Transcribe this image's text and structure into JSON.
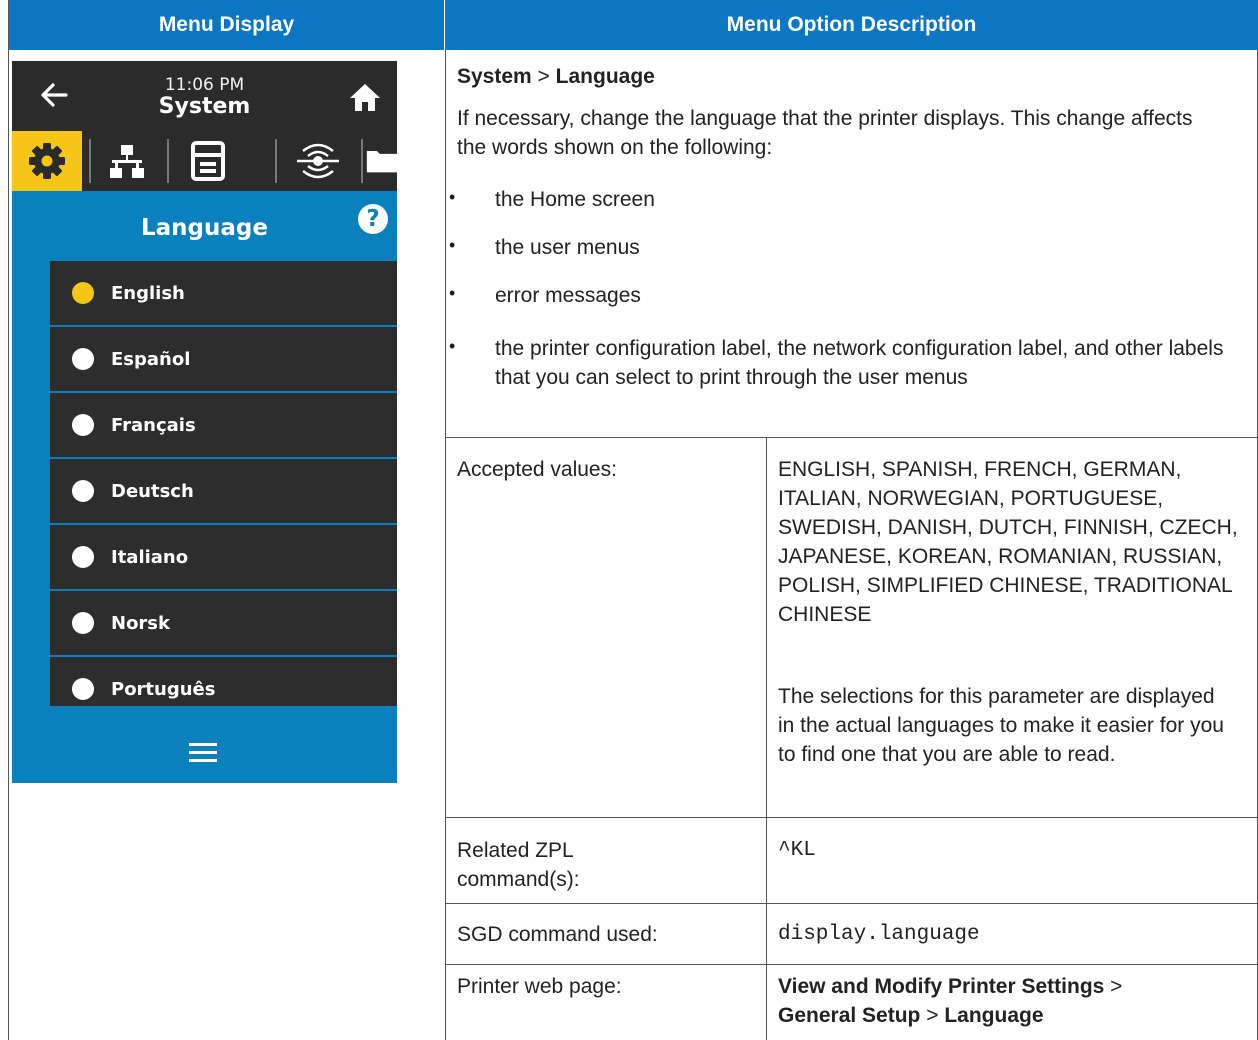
{
  "headers": {
    "left": "Menu Display",
    "right": "Menu Option Description"
  },
  "device": {
    "time": "11:06 PM",
    "title": "System",
    "section": "Language",
    "help": "?",
    "languages": [
      {
        "label": "English",
        "selected": true
      },
      {
        "label": "Español",
        "selected": false
      },
      {
        "label": "Français",
        "selected": false
      },
      {
        "label": "Deutsch",
        "selected": false
      },
      {
        "label": "Italiano",
        "selected": false
      },
      {
        "label": "Norsk",
        "selected": false
      },
      {
        "label": "Português",
        "selected": false
      }
    ],
    "tabs": [
      "gear-icon",
      "network-icon",
      "printer-icon",
      "connectivity-icon",
      "folder-icon"
    ],
    "accent": "#f5c518",
    "screen_bg": "#0a80bd"
  },
  "description": {
    "path_system": "System",
    "path_sep": " > ",
    "path_language": "Language",
    "intro": "If necessary, change the language that the printer displays. This change affects the words shown on the following:",
    "bullets": [
      "the Home screen",
      "the user menus",
      "error messages",
      "the printer configuration label, the network configuration label, and other labels that you can select to print through the user menus"
    ]
  },
  "rows": {
    "accepted_label": "Accepted values:",
    "accepted_values": "ENGLISH, SPANISH, FRENCH, GERMAN, ITALIAN, NORWEGIAN, PORTUGUESE, SWEDISH, DANISH, DUTCH, FINNISH, CZECH, JAPANESE, KOREAN, ROMANIAN, RUSSIAN, POLISH, SIMPLIFIED CHINESE, TRADITIONAL CHINESE",
    "accepted_note": "The selections for this parameter are displayed in the actual languages to make it easier for you to find one that you are able to read.",
    "zpl_label": "Related ZPL command(s):",
    "zpl_value": "^KL",
    "sgd_label": "SGD command used:",
    "sgd_value": "display.language",
    "web_label": "Printer web page:",
    "web_part1": "View and Modify Printer Settings",
    "web_sep": " > ",
    "web_part2": "General Setup",
    "web_sep2": " > ",
    "web_part3": "Language"
  }
}
